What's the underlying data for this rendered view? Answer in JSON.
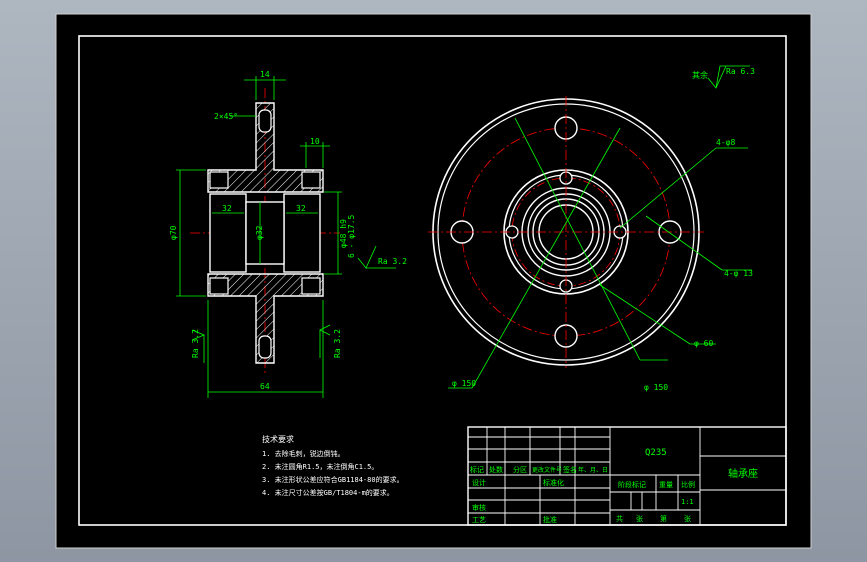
{
  "colors": {
    "background": "#000000",
    "frame": "#ffffff",
    "outline": "#ffffff",
    "dimension": "#00ff00",
    "centerline": "#ff0000",
    "hatch": "#ffffff",
    "table_text": "#00ff00",
    "title_text": "#00ff00"
  },
  "front_view": {
    "dims": {
      "top_width": "14",
      "chamfer": "2×45°",
      "step_width": "10",
      "height_left": "φ70",
      "bore_left": "32",
      "bore_center": "φ32",
      "bore_right": "32",
      "fit_right": "φ48 h9",
      "fit_right_2": "6 - φ17.5",
      "surface_right": "Ra 3.2",
      "surface_left_lower": "Ra 3.2",
      "surface_right_lower": "Ra 3.2",
      "total_width": "64"
    }
  },
  "side_view": {
    "surface_note_prefix": "其余",
    "surface_note": "Ra 6.3",
    "callout_holes_small": "4-φ8",
    "callout_holes_large": "4-φ 13",
    "callout_d60": "φ 60",
    "callout_d150_left": "φ 150",
    "callout_d150_right": "φ 150"
  },
  "tech_requirements": {
    "title": "技术要求",
    "lines": [
      "1. 去除毛刺，锐边倒钝。",
      "2. 未注圆角R1.5，未注倒角C1.5。",
      "3. 未注形状公差应符合GB1184-80的要求。",
      "4. 未注尺寸公差按GB/T1804-m的要求。"
    ]
  },
  "title_block": {
    "material": "Q235",
    "part_name": "轴承座",
    "header_row": [
      "标记",
      "处数",
      "分区",
      "更改文件号",
      "签名",
      "年、月、日"
    ],
    "designer": "设计",
    "standardization": "标准化",
    "reviewer": "审核",
    "process": "工艺",
    "approve": "批准",
    "stage_mark": "阶段标记",
    "weight": "重量",
    "scale": "比例",
    "scale_value": "1:1",
    "sheet_row": [
      "共",
      "张",
      "第",
      "张"
    ]
  }
}
